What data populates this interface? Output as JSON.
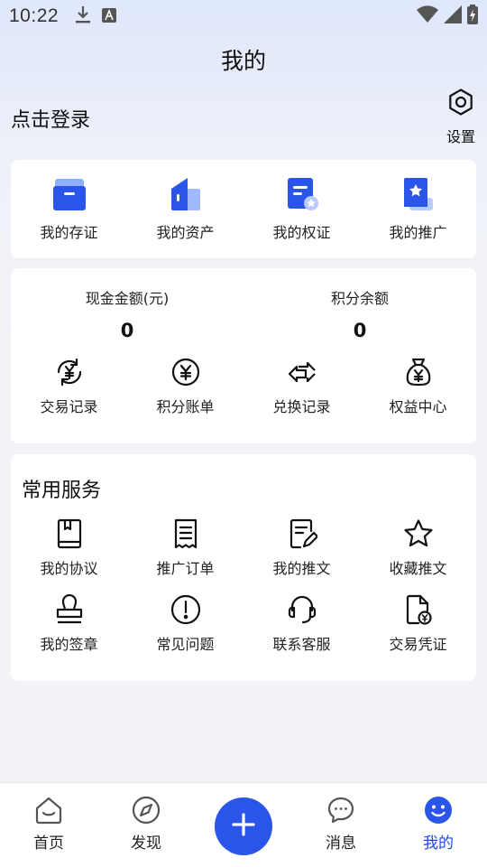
{
  "status_bar": {
    "time": "10:22"
  },
  "page": {
    "title": "我的"
  },
  "login": {
    "label": "点击登录"
  },
  "settings": {
    "label": "设置",
    "icon": "gear-icon"
  },
  "assets_row": [
    {
      "label": "我的存证",
      "icon": "evidence-box-icon"
    },
    {
      "label": "我的资产",
      "icon": "asset-building-icon"
    },
    {
      "label": "我的权证",
      "icon": "certificate-icon"
    },
    {
      "label": "我的推广",
      "icon": "promotion-star-icon"
    }
  ],
  "balances": {
    "cash": {
      "label": "现金金额(元)",
      "value": "0"
    },
    "points": {
      "label": "积分余额",
      "value": "0"
    }
  },
  "finance_row": [
    {
      "label": "交易记录",
      "icon": "yuan-cycle-icon"
    },
    {
      "label": "积分账单",
      "icon": "yuan-circle-icon"
    },
    {
      "label": "兑换记录",
      "icon": "exchange-arrows-icon"
    },
    {
      "label": "权益中心",
      "icon": "money-bag-icon"
    }
  ],
  "services": {
    "title": "常用服务",
    "row1": [
      {
        "label": "我的协议",
        "icon": "agreement-book-icon"
      },
      {
        "label": "推广订单",
        "icon": "receipt-icon"
      },
      {
        "label": "我的推文",
        "icon": "edit-document-icon"
      },
      {
        "label": "收藏推文",
        "icon": "star-icon"
      }
    ],
    "row2": [
      {
        "label": "我的签章",
        "icon": "stamp-icon"
      },
      {
        "label": "常见问题",
        "icon": "exclamation-circle-icon"
      },
      {
        "label": "联系客服",
        "icon": "headset-icon"
      },
      {
        "label": "交易凭证",
        "icon": "voucher-document-icon"
      }
    ]
  },
  "tabbar": {
    "home": "首页",
    "discover": "发现",
    "messages": "消息",
    "mine": "我的",
    "accent": "#2049e0"
  }
}
